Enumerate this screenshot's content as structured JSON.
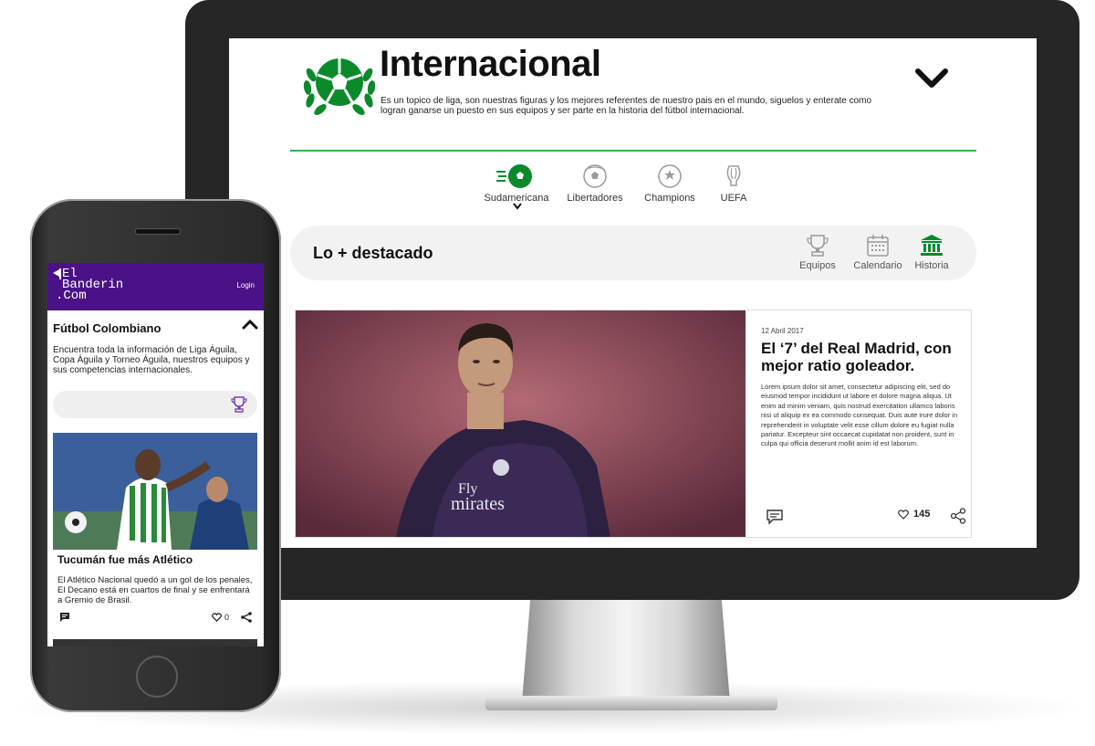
{
  "desktop": {
    "title": "Internacional",
    "description": "Es un topico de liga, son nuestras figuras y los mejores referentes de nuestro pais en el mundo, siguelos y enterate como logran ganarse un puesto en sus equipos y ser parte en la historia del fútbol internacional.",
    "leagues": [
      {
        "label": "Sudamericana",
        "icon": "soccer-ball-icon",
        "selected": true
      },
      {
        "label": "Libertadores",
        "icon": "libertadores-ball-icon",
        "selected": false
      },
      {
        "label": "Champions",
        "icon": "champions-ball-icon",
        "selected": false
      },
      {
        "label": "UEFA",
        "icon": "uefa-cup-icon",
        "selected": false
      }
    ],
    "highlights": {
      "title": "Lo + destacado",
      "tabs": [
        {
          "label": "Equipos",
          "icon": "trophy-icon",
          "active": false
        },
        {
          "label": "Calendario",
          "icon": "calendar-icon",
          "active": false
        },
        {
          "label": "Historia",
          "icon": "museum-icon",
          "active": true
        }
      ]
    },
    "article": {
      "date": "12 Abril 2017",
      "headline": "El ‘7’ del Real Madrid, con mejor ratio goleador.",
      "body": "Lorem ipsum dolor sit amet, consectetur adipiscing elit, sed do eiusmod tempor incididunt ut labore et dolore magna aliqua. Ut enim ad minim veniam, quis nostrud exercitation ullamco laboris nisi ut aliquip ex ea commodo consequat. Duis aute irure dolor in reprehenderit in voluptate velit esse cillum dolore eu fugiat nulla pariatur. Excepteur sint occaecat cupidatat non proident, sunt in culpa qui officia deserunt mollit anim id est laborum.",
      "photo_text": "Fly\nmirates",
      "likes": "145"
    }
  },
  "mobile": {
    "logo_lines": [
      "El",
      "Banderin",
      ".Com"
    ],
    "login_label": "Login",
    "section_title": "Fútbol Colombiano",
    "section_desc": "Encuentra toda la información de Liga Águila, Copa Águila y Torneo Águila, nuestros equipos y sus competencias internacionales.",
    "news": {
      "title": "Tucumán fue más Atlético",
      "text": "El Atlético Nacional quedó a un gol de los penales, El Decano está en cuartos de final y se enfrentará a Gremio de Brasil.",
      "likes": "0"
    }
  },
  "colors": {
    "brand_green": "#0a8a2a",
    "rule_green": "#36b34a",
    "mobile_purple": "#4a1286",
    "mobile_accent": "#7a3fb5"
  }
}
